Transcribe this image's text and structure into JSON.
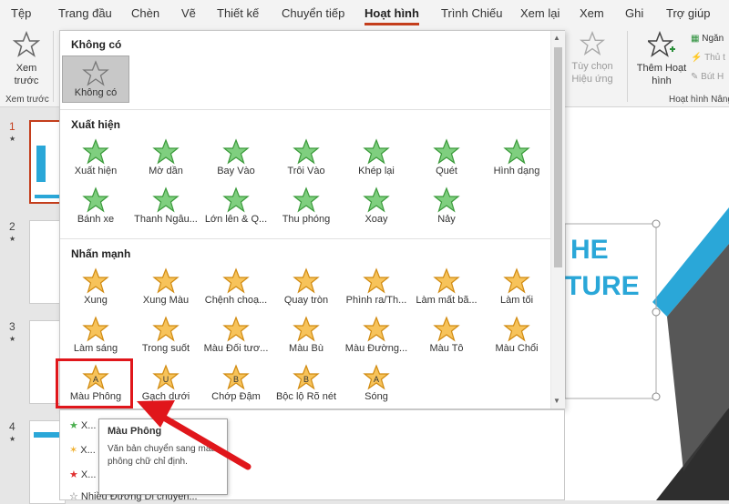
{
  "tabs": [
    "Tệp",
    "Trang đầu",
    "Chèn",
    "Vẽ",
    "Thiết kế",
    "Chuyển tiếp",
    "Hoạt hình",
    "Trình Chiếu",
    "Xem lại",
    "Xem",
    "Ghi",
    "Trợ giúp"
  ],
  "ribbon": {
    "preview_label": "Xem\ntrước",
    "preview_group": "Xem trước",
    "effect_options": "Tùy chọn\nHiệu ứng",
    "add_animation": "Thêm Hoạt\nhình",
    "advanced_group": "Hoạt hình Nâng",
    "pane_short": "Ngăn",
    "trigger_short": "Thủ t",
    "painter_short": "Bút H"
  },
  "gallery": {
    "none_header": "Không có",
    "none_item": "Không có",
    "entrance_header": "Xuất hiện",
    "entrance": [
      "Xuất hiện",
      "Mờ dần",
      "Bay Vào",
      "Trôi Vào",
      "Khép lại",
      "Quét",
      "Hình dạng",
      "Bánh xe",
      "Thanh Ngẫu...",
      "Lớn lên & Q...",
      "Thu phóng",
      "Xoay",
      "Nảy"
    ],
    "emphasis_header": "Nhấn mạnh",
    "emphasis": [
      "Xung",
      "Xung Màu",
      "Chệnh choạ...",
      "Quay tròn",
      "Phình ra/Th...",
      "Làm mất bã...",
      "Làm tối",
      "Làm sáng",
      "Trong suốt",
      "Màu Đối tươ...",
      "Màu Bù",
      "Màu Đường...",
      "Màu Tô",
      "Màu Chổi",
      "Màu Phông",
      "Gạch dưới",
      "Chớp Đậm",
      "Bộc lộ Rõ nét",
      "Sóng"
    ]
  },
  "more_items": [
    "X... hiện...",
    "X... Nhấn mạnh...",
    "X...",
    "Nhiều Đường Di chuyển..."
  ],
  "tooltip": {
    "title": "Màu Phông",
    "desc": "Văn bản chuyển sang màu phông chữ chỉ định."
  },
  "slide_numbers": [
    "1",
    "2",
    "3",
    "4"
  ],
  "slide_text": [
    "HE",
    "TURE"
  ],
  "colors": {
    "accent": "#c43e1c",
    "highlight": "#e0161b",
    "entrance": "#4caf50",
    "emphasis": "#f0b030",
    "slide_blue": "#2aa7d8"
  }
}
